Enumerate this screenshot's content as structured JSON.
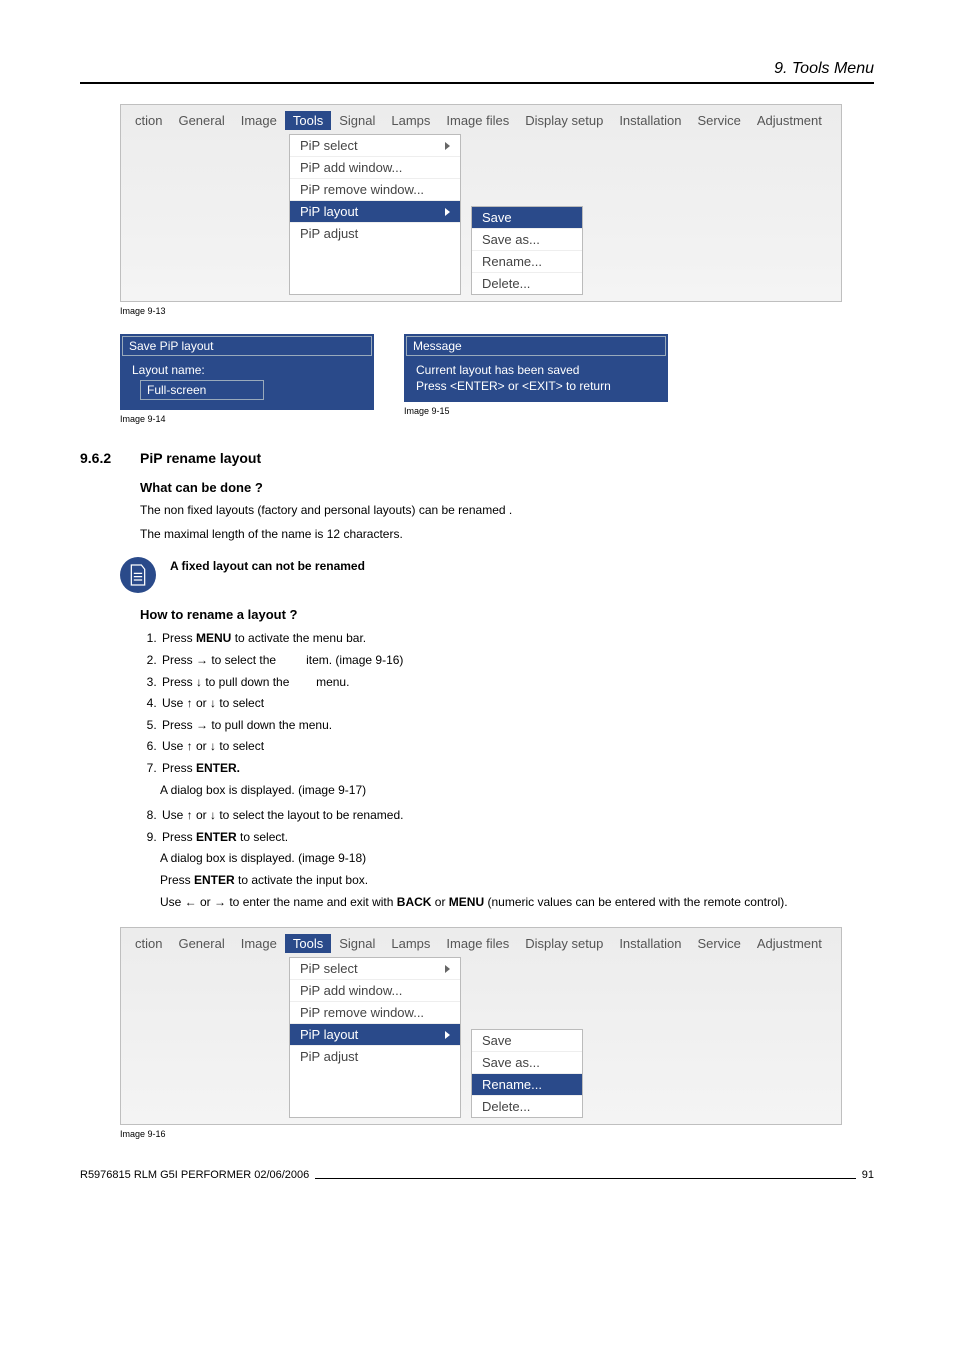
{
  "chapter": "9.  Tools Menu",
  "menubar": [
    "ction",
    "General",
    "Image",
    "Tools",
    "Signal",
    "Lamps",
    "Image files",
    "Display setup",
    "Installation",
    "Service",
    "Adjustment"
  ],
  "menubar_selected": "Tools",
  "tools_dropdown": [
    {
      "label": "PiP select",
      "arrow": true
    },
    {
      "label": "PiP add window..."
    },
    {
      "label": "PiP remove window..."
    },
    {
      "label": "PiP layout",
      "arrow": true
    },
    {
      "label": "PiP adjust"
    }
  ],
  "layout_dropdown": [
    "Save",
    "Save as...",
    "Rename...",
    "Delete..."
  ],
  "img913": {
    "caption": "Image 9-13",
    "tools_sel": "PiP layout",
    "layout_sel": "Save"
  },
  "img916": {
    "caption": "Image 9-16",
    "tools_sel": "PiP layout",
    "layout_sel": "Rename..."
  },
  "dialog_save": {
    "title": "Save PiP layout",
    "label": "Layout name:",
    "value": "Full-screen",
    "caption": "Image 9-14"
  },
  "dialog_msg": {
    "title": "Message",
    "line1": "Current layout has been saved",
    "line2": "Press <ENTER> or <EXIT> to return",
    "caption": "Image 9-15"
  },
  "section": {
    "num": "9.6.2",
    "title": "PiP rename layout"
  },
  "sub1": "What can be done ?",
  "p1": "The non fixed layouts (factory and personal layouts) can be renamed .",
  "p2": "The maximal length of the name is 12 characters.",
  "note": "A fixed layout can not be renamed",
  "sub2": "How to rename a layout ?",
  "steps": {
    "s1a": "Press ",
    "s1b": "MENU",
    "s1c": " to activate the menu bar.",
    "s2a": "Press → to select the ",
    "s2b": "item.  (image 9-16)",
    "s3a": "Press ↓ to pull down the ",
    "s3b": "menu.",
    "s4": "Use ↑ or ↓ to select",
    "s5": "Press → to pull down the menu.",
    "s6": "Use ↑ or ↓ to select",
    "s7a": "Press ",
    "s7b": "ENTER.",
    "s7sub": "A dialog box is displayed.  (image 9-17)",
    "s8": "Use ↑ or ↓ to select the layout to be renamed.",
    "s9a": "Press ",
    "s9b": "ENTER",
    "s9c": " to select.",
    "s9sub1": "A dialog box is displayed.  (image 9-18)",
    "s9sub2a": "Press ",
    "s9sub2b": "ENTER",
    "s9sub2c": " to activate the input box.",
    "s9sub3a": "Use ← or → to enter the name and exit with ",
    "s9sub3b": "BACK",
    "s9sub3c": " or ",
    "s9sub3d": "MENU",
    "s9sub3e": " (numeric values can be entered with the remote control)."
  },
  "footer": {
    "left": "R5976815  RLM G5I PERFORMER  02/06/2006",
    "right": "91"
  }
}
